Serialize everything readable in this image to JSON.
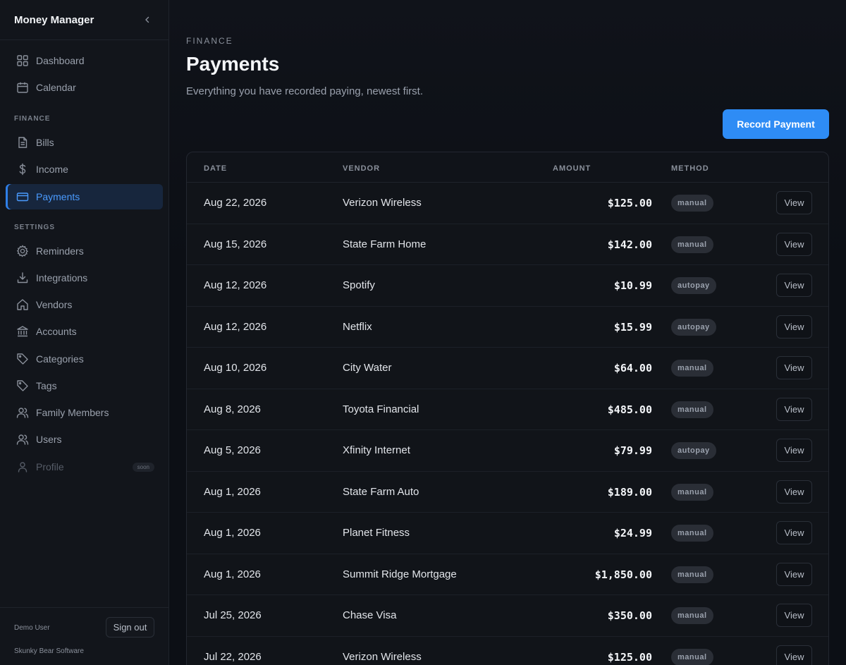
{
  "app": {
    "title": "Money Manager"
  },
  "sidebar": {
    "items_top": [
      {
        "label": "Dashboard",
        "icon": "dashboard-grid-icon"
      },
      {
        "label": "Calendar",
        "icon": "calendar-icon"
      }
    ],
    "finance_heading": "FINANCE",
    "finance_items": [
      {
        "label": "Bills",
        "icon": "document-icon"
      },
      {
        "label": "Income",
        "icon": "dollar-icon"
      },
      {
        "label": "Payments",
        "icon": "credit-card-icon",
        "active": true
      }
    ],
    "settings_heading": "SETTINGS",
    "settings_items": [
      {
        "label": "Reminders",
        "icon": "gear-icon"
      },
      {
        "label": "Integrations",
        "icon": "download-icon"
      },
      {
        "label": "Vendors",
        "icon": "home-icon"
      },
      {
        "label": "Accounts",
        "icon": "bank-icon"
      },
      {
        "label": "Categories",
        "icon": "tag-icon"
      },
      {
        "label": "Tags",
        "icon": "tag-icon"
      },
      {
        "label": "Family Members",
        "icon": "users-icon"
      },
      {
        "label": "Users",
        "icon": "users-icon"
      },
      {
        "label": "Profile",
        "icon": "user-icon",
        "badge": "soon",
        "disabled": true
      }
    ],
    "footer": {
      "user": "Demo User",
      "company": "Skunky Bear Software",
      "signout": "Sign out"
    }
  },
  "page": {
    "eyebrow": "FINANCE",
    "title": "Payments",
    "subtitle": "Everything you have recorded paying, newest first.",
    "primary_action": "Record Payment"
  },
  "table": {
    "columns": [
      "DATE",
      "VENDOR",
      "AMOUNT",
      "METHOD"
    ],
    "view_label": "View",
    "rows": [
      {
        "date": "Aug 22, 2026",
        "vendor": "Verizon Wireless",
        "amount": "$125.00",
        "method": "manual"
      },
      {
        "date": "Aug 15, 2026",
        "vendor": "State Farm Home",
        "amount": "$142.00",
        "method": "manual"
      },
      {
        "date": "Aug 12, 2026",
        "vendor": "Spotify",
        "amount": "$10.99",
        "method": "autopay"
      },
      {
        "date": "Aug 12, 2026",
        "vendor": "Netflix",
        "amount": "$15.99",
        "method": "autopay"
      },
      {
        "date": "Aug 10, 2026",
        "vendor": "City Water",
        "amount": "$64.00",
        "method": "manual"
      },
      {
        "date": "Aug 8, 2026",
        "vendor": "Toyota Financial",
        "amount": "$485.00",
        "method": "manual"
      },
      {
        "date": "Aug 5, 2026",
        "vendor": "Xfinity Internet",
        "amount": "$79.99",
        "method": "autopay"
      },
      {
        "date": "Aug 1, 2026",
        "vendor": "State Farm Auto",
        "amount": "$189.00",
        "method": "manual"
      },
      {
        "date": "Aug 1, 2026",
        "vendor": "Planet Fitness",
        "amount": "$24.99",
        "method": "manual"
      },
      {
        "date": "Aug 1, 2026",
        "vendor": "Summit Ridge Mortgage",
        "amount": "$1,850.00",
        "method": "manual"
      },
      {
        "date": "Jul 25, 2026",
        "vendor": "Chase Visa",
        "amount": "$350.00",
        "method": "manual"
      },
      {
        "date": "Jul 22, 2026",
        "vendor": "Verizon Wireless",
        "amount": "$125.00",
        "method": "manual"
      }
    ]
  },
  "colors": {
    "accent": "#2e8cf5",
    "active_nav_text": "#4a9bff",
    "background": "#0c0f15"
  }
}
